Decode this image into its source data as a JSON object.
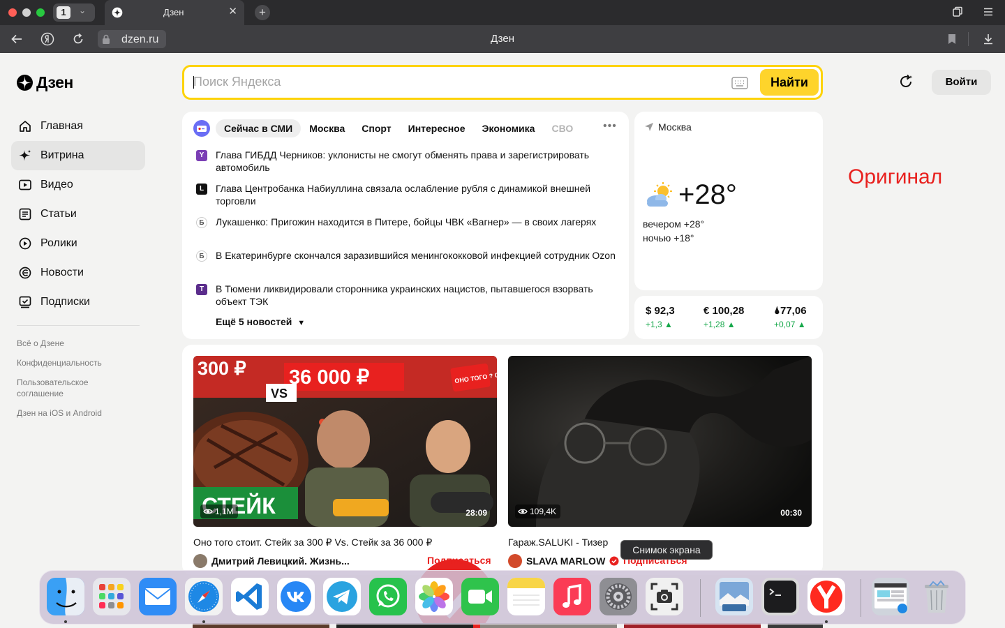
{
  "browser": {
    "tab_count": "1",
    "tab_title": "Дзен",
    "url": "dzen.ru",
    "page_title": "Дзен"
  },
  "logo": {
    "text": "Дзен"
  },
  "search": {
    "placeholder": "Поиск Яндекса",
    "button": "Найти"
  },
  "header": {
    "login": "Войти"
  },
  "nav": [
    {
      "label": "Главная",
      "icon": "home-icon"
    },
    {
      "label": "Витрина",
      "icon": "sparkle-icon",
      "active": true
    },
    {
      "label": "Видео",
      "icon": "video-icon"
    },
    {
      "label": "Статьи",
      "icon": "article-icon"
    },
    {
      "label": "Ролики",
      "icon": "shorts-icon"
    },
    {
      "label": "Новости",
      "icon": "news-icon"
    },
    {
      "label": "Подписки",
      "icon": "subscriptions-icon"
    }
  ],
  "footer_links": [
    "Всё о Дзене",
    "Конфиденциальность",
    "Пользовательское соглашение",
    "Дзен на iOS и Android"
  ],
  "news": {
    "tabs": [
      "Сейчас в СМИ",
      "Москва",
      "Спорт",
      "Интересное",
      "Экономика",
      "СВО"
    ],
    "items": [
      {
        "text": "Глава ГИБДД Черников: уклонисты не смогут обменять права и зарегистрировать автомобиль",
        "source_letter": "Y",
        "source_color": "#7b3fb5"
      },
      {
        "text": "Глава Центробанка Набиуллина связала ослабление рубля с динамикой внешней торговли",
        "source_letter": "L",
        "source_color": "#111111"
      },
      {
        "text": "Лукашенко: Пригожин находится в Питере, бойцы ЧВК «Вагнер» — в своих лагерях",
        "source_letter": "Б",
        "source_color": "#9a9a9a"
      },
      {
        "text": "В Екатеринбурге скончался заразившийся менингококковой инфекцией сотрудник Ozon",
        "source_letter": "Б",
        "source_color": "#9a9a9a"
      },
      {
        "text": "В Тюмени ликвидировали сторонника украинских нацистов, пытавшегося взорвать объект ТЭК",
        "source_letter": "T",
        "source_color": "#5b2d8c"
      }
    ],
    "more": "Ещё 5 новостей"
  },
  "weather": {
    "city": "Москва",
    "temp": "+28°",
    "evening": "вечером +28°",
    "night": "ночью +18°"
  },
  "rates": [
    {
      "value": "$ 92,3",
      "delta": "+1,3 ▲"
    },
    {
      "value": "€ 100,28",
      "delta": "+1,28 ▲"
    },
    {
      "value": "🌢77,06",
      "delta": "+0,07 ▲"
    }
  ],
  "overlay_label": "Оригинал",
  "feed": [
    {
      "views": "1,1M",
      "duration": "28:09",
      "title": "Оно того стоит. Стейк за 300 ₽ Vs. Стейк за 36 000 ₽",
      "channel": "Дмитрий Левицкий. Жизнь...",
      "subscribe": "Подписаться",
      "thumb_text": {
        "price_low": "300 ₽",
        "price_high": "36 000 ₽",
        "vs": "VS",
        "badge": "ОНО ТОГО ? СТОИТ",
        "word": "СТЕЙК"
      }
    },
    {
      "views": "109,4K",
      "duration": "00:30",
      "title": "Гараж.SALUKI - Тизер",
      "channel": "SLAVA MARLOW",
      "subscribe": "Подписаться"
    }
  ],
  "tooltip": "Снимок экрана",
  "dock": [
    {
      "name": "finder-icon",
      "running": true
    },
    {
      "name": "launchpad-icon"
    },
    {
      "name": "mail-icon"
    },
    {
      "name": "safari-icon",
      "running": true
    },
    {
      "name": "vscode-icon"
    },
    {
      "name": "vk-icon"
    },
    {
      "name": "telegram-icon"
    },
    {
      "name": "whatsapp-icon"
    },
    {
      "name": "photos-icon"
    },
    {
      "name": "facetime-icon"
    },
    {
      "name": "notes-icon"
    },
    {
      "name": "music-icon"
    },
    {
      "name": "system-settings-icon"
    },
    {
      "name": "screenshot-icon"
    },
    {
      "name": "preview-icon"
    },
    {
      "name": "terminal-icon"
    },
    {
      "name": "yandex-browser-icon",
      "running": true
    },
    {
      "name": "downloads-stack-icon"
    },
    {
      "name": "trash-icon"
    }
  ],
  "colors": {
    "accent_yellow": "#fed42b",
    "subscribe_red": "#e8211f",
    "rate_green": "#17a84b"
  }
}
